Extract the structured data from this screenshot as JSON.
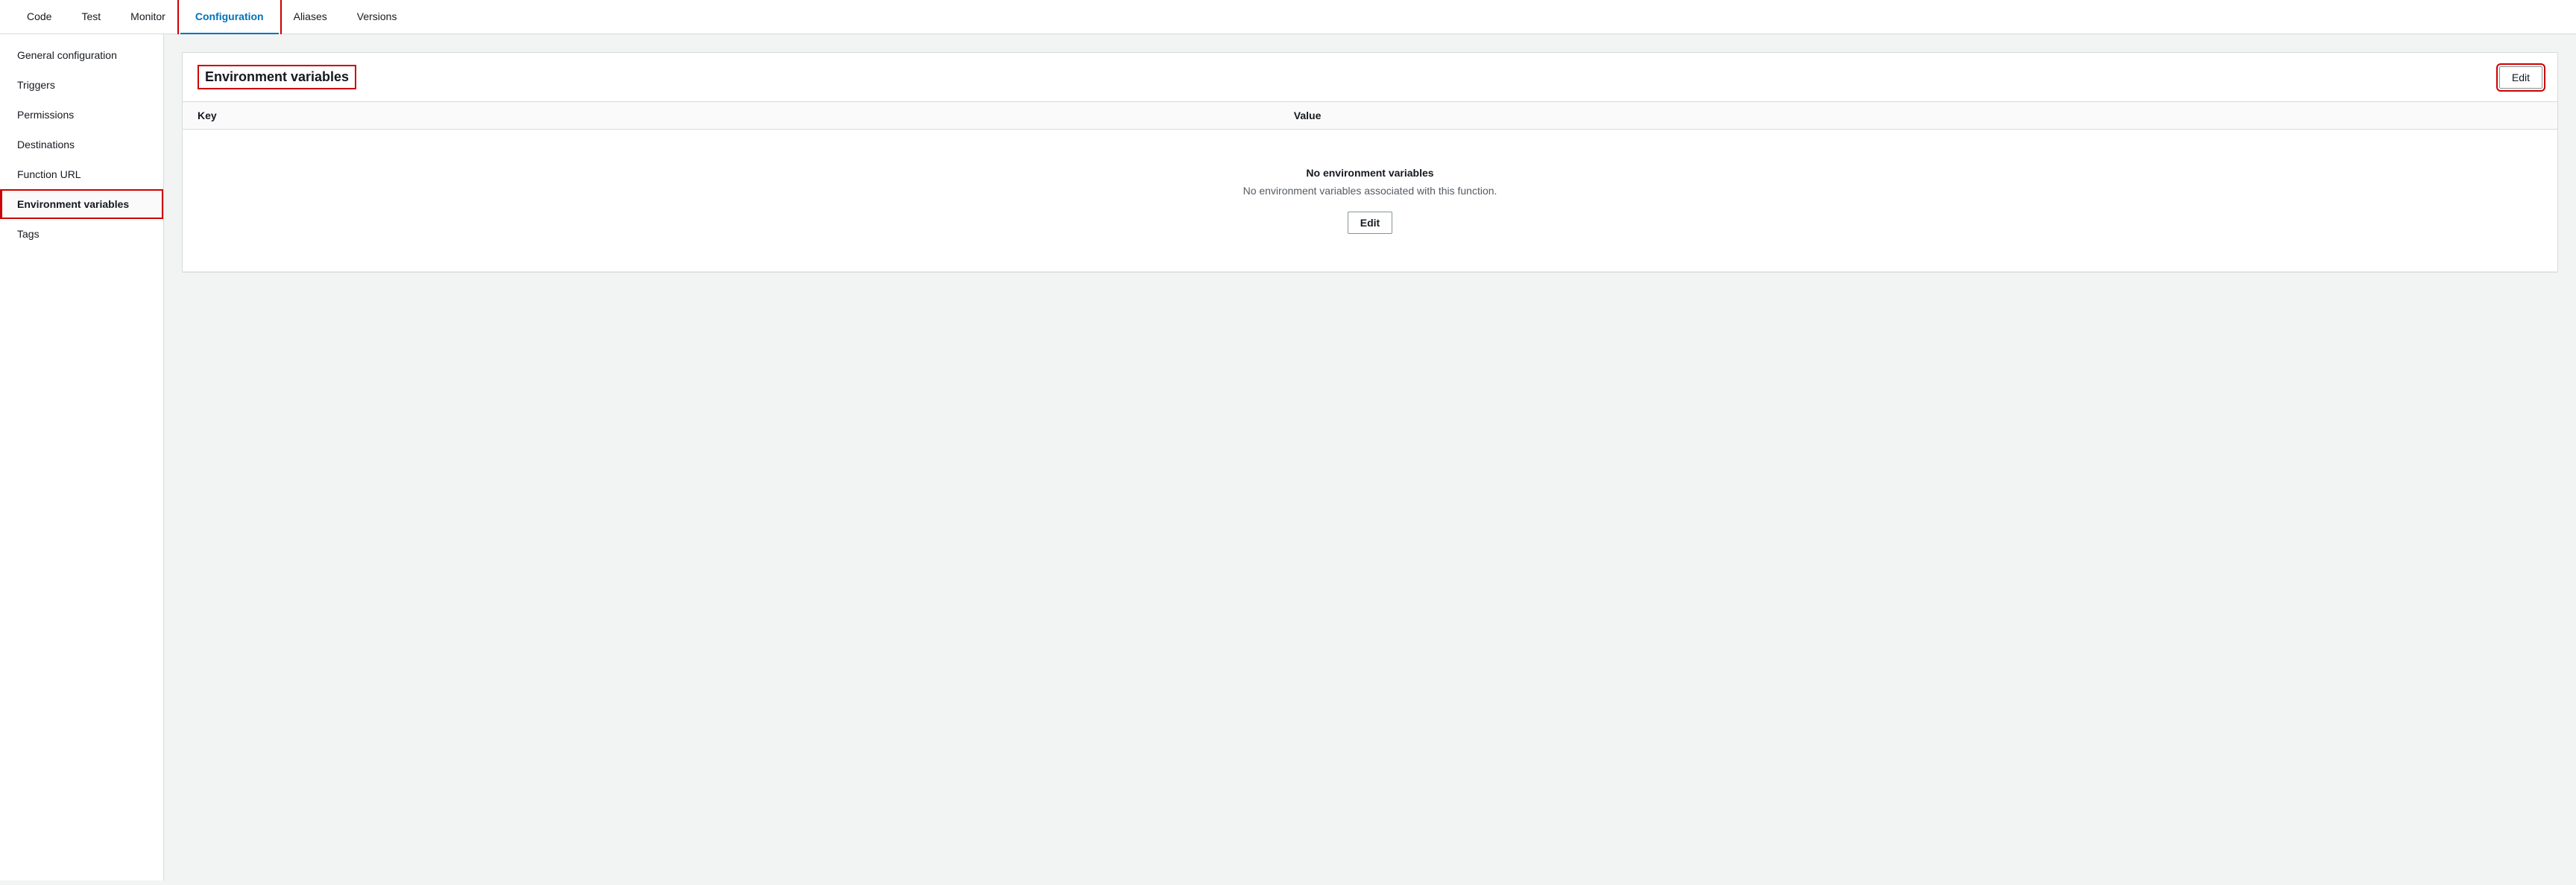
{
  "tabs": [
    {
      "id": "code",
      "label": "Code",
      "active": false
    },
    {
      "id": "test",
      "label": "Test",
      "active": false
    },
    {
      "id": "monitor",
      "label": "Monitor",
      "active": false
    },
    {
      "id": "configuration",
      "label": "Configuration",
      "active": true
    },
    {
      "id": "aliases",
      "label": "Aliases",
      "active": false
    },
    {
      "id": "versions",
      "label": "Versions",
      "active": false
    }
  ],
  "sidebar": {
    "items": [
      {
        "id": "general-configuration",
        "label": "General configuration",
        "active": false
      },
      {
        "id": "triggers",
        "label": "Triggers",
        "active": false
      },
      {
        "id": "permissions",
        "label": "Permissions",
        "active": false
      },
      {
        "id": "destinations",
        "label": "Destinations",
        "active": false
      },
      {
        "id": "function-url",
        "label": "Function URL",
        "active": false
      },
      {
        "id": "environment-variables",
        "label": "Environment variables",
        "active": true
      },
      {
        "id": "tags",
        "label": "Tags",
        "active": false
      }
    ]
  },
  "panel": {
    "title": "Environment variables",
    "edit_button_label": "Edit",
    "table": {
      "columns": [
        {
          "id": "key",
          "label": "Key"
        },
        {
          "id": "value",
          "label": "Value"
        }
      ]
    },
    "empty_state": {
      "title": "No environment variables",
      "description": "No environment variables associated with this function.",
      "edit_button_label": "Edit"
    }
  }
}
